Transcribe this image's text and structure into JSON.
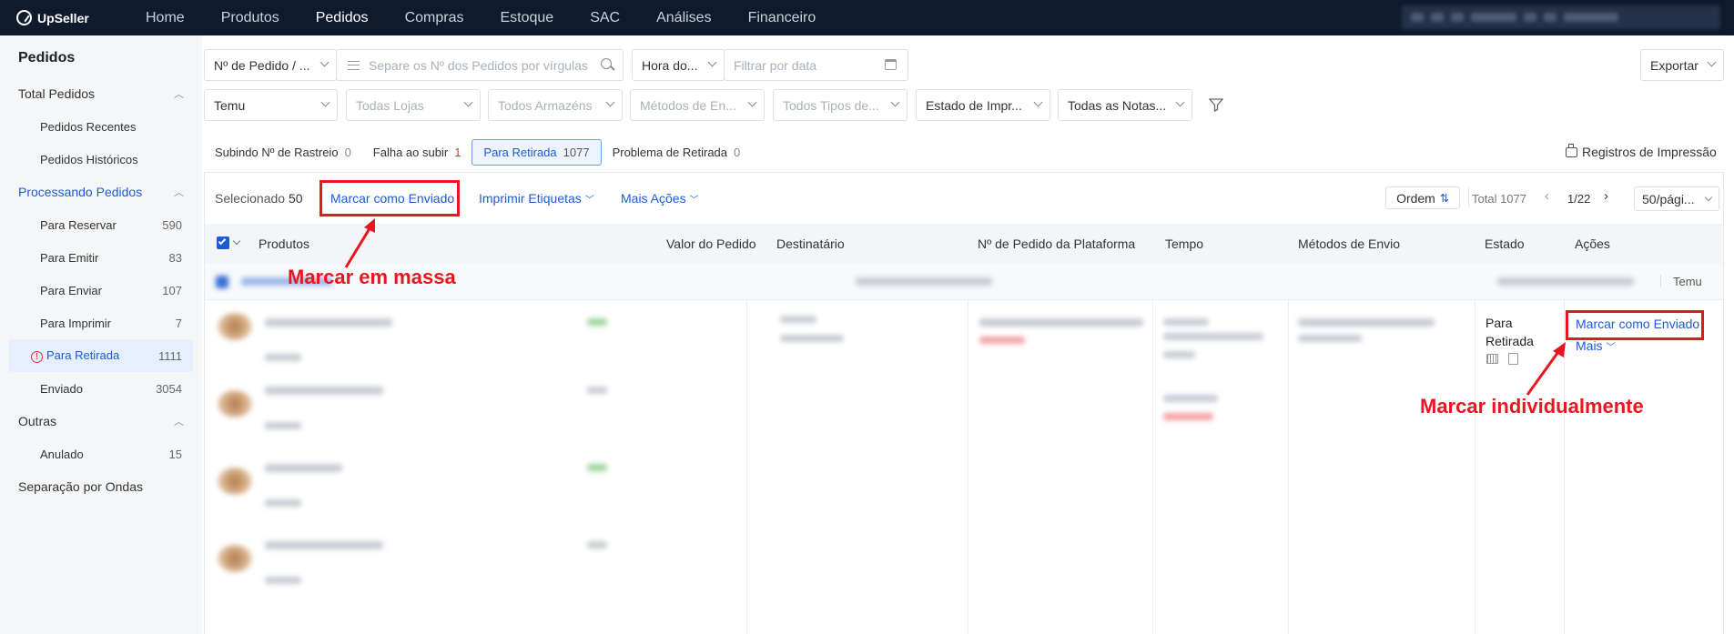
{
  "topnav": {
    "brand": "UpSeller",
    "items": [
      "Home",
      "Produtos",
      "Pedidos",
      "Compras",
      "Estoque",
      "SAC",
      "Análises",
      "Financeiro"
    ],
    "active": "Pedidos"
  },
  "sidebar": {
    "title": "Pedidos",
    "total_group": "Total Pedidos",
    "recent": "Pedidos Recentes",
    "history": "Pedidos Históricos",
    "processing_group": "Processando Pedidos",
    "items": [
      {
        "label": "Para Reservar",
        "count": "590"
      },
      {
        "label": "Para Emitir",
        "count": "83"
      },
      {
        "label": "Para Enviar",
        "count": "107"
      },
      {
        "label": "Para Imprimir",
        "count": "7"
      },
      {
        "label": "Para Retirada",
        "count": "1111"
      },
      {
        "label": "Enviado",
        "count": "3054"
      }
    ],
    "other_group": "Outras",
    "cancelled": {
      "label": "Anulado",
      "count": "15"
    },
    "waves": "Separação por Ondas"
  },
  "filters": {
    "order_type": "Nº de Pedido / ...",
    "search_placeholder": "Separe os Nº dos Pedidos por vírgulas",
    "time_type": "Hora do...",
    "date_placeholder": "Filtrar por data",
    "export": "Exportar",
    "platform": "Temu",
    "stores": "Todas Lojas",
    "warehouses": "Todos Armazéns",
    "shipping_methods": "Métodos de En...",
    "types": "Todos Tipos de...",
    "print_status": "Estado de Impr...",
    "notes": "Todas as Notas..."
  },
  "tabs": [
    {
      "label": "Subindo Nº de Rastreio",
      "count": "0"
    },
    {
      "label": "Falha ao subir",
      "count": "1"
    },
    {
      "label": "Para Retirada",
      "count": "1077"
    },
    {
      "label": "Problema de Retirada",
      "count": "0"
    }
  ],
  "print_log": "Registros de Impressão",
  "toolbar": {
    "selected_label": "Selecionado",
    "selected_count": "50",
    "mark_shipped": "Marcar como Enviado",
    "print_labels": "Imprimir Etiquetas",
    "more_actions": "Mais Ações",
    "order_button": "Ordem",
    "total": "Total 1077",
    "page": "1/22",
    "page_size": "50/pági..."
  },
  "table": {
    "headers": [
      "Produtos",
      "Valor do Pedido",
      "Destinatário",
      "Nº de Pedido da Plataforma",
      "Tempo",
      "Métodos de Envio",
      "Estado",
      "Ações"
    ],
    "group_platform": "Temu",
    "row1_status": "Para Retirada",
    "row1_action": "Marcar como Enviado",
    "row1_more": "Mais"
  },
  "annotations": {
    "bulk": "Marcar em massa",
    "individual": "Marcar individualmente",
    "color": "#e8171f"
  }
}
